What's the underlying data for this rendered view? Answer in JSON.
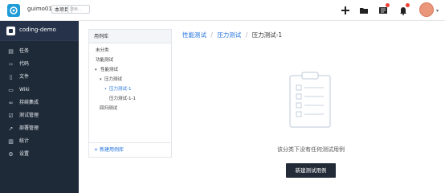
{
  "topbar": {
    "user_name": "guimo01",
    "scope_label": "本项目",
    "search_placeholder": "搜索...",
    "icons": [
      "logo-icon",
      "plus-icon",
      "folder-icon",
      "notifications-list-icon",
      "bell-icon",
      "user-avatar"
    ],
    "accent_color": "#1e9cd7",
    "badge_color": "#f04134"
  },
  "sidebar": {
    "project_name": "coding-demo",
    "items": [
      {
        "label": "任务",
        "icon": "task-icon"
      },
      {
        "label": "代码",
        "icon": "code-icon"
      },
      {
        "label": "文件",
        "icon": "file-icon"
      },
      {
        "label": "Wiki",
        "icon": "wiki-icon"
      },
      {
        "label": "持续集成",
        "icon": "ci-icon"
      },
      {
        "label": "测试管理",
        "icon": "test-icon"
      },
      {
        "label": "部署管理",
        "icon": "deploy-icon"
      },
      {
        "label": "统计",
        "icon": "stats-icon"
      },
      {
        "label": "设置",
        "icon": "settings-icon"
      }
    ],
    "bg_color": "#1f2a38"
  },
  "library": {
    "header": "用例库",
    "tree": [
      {
        "label": "未分类",
        "level": 0,
        "active": false,
        "caret": ""
      },
      {
        "label": "功能测试",
        "level": 0,
        "active": false,
        "caret": ""
      },
      {
        "label": "性能测试",
        "level": 0,
        "active": false,
        "caret": "▾"
      },
      {
        "label": "压力测试",
        "level": 1,
        "active": false,
        "caret": "▾"
      },
      {
        "label": "压力测试-1",
        "level": 2,
        "active": true,
        "caret": "•"
      },
      {
        "label": "压力测试-1-1",
        "level": 3,
        "active": false,
        "caret": ""
      },
      {
        "label": "回归测试",
        "level": 0,
        "active": false,
        "caret": ""
      }
    ],
    "footer_label": "新建用例库"
  },
  "breadcrumb": {
    "items": [
      "性能测试",
      "压力测试",
      "压力测试-1"
    ],
    "separator": "/"
  },
  "empty_state": {
    "message": "该分类下没有任何测试用例",
    "button_label": "新建测试用例",
    "illustration": "clipboard-icon"
  }
}
